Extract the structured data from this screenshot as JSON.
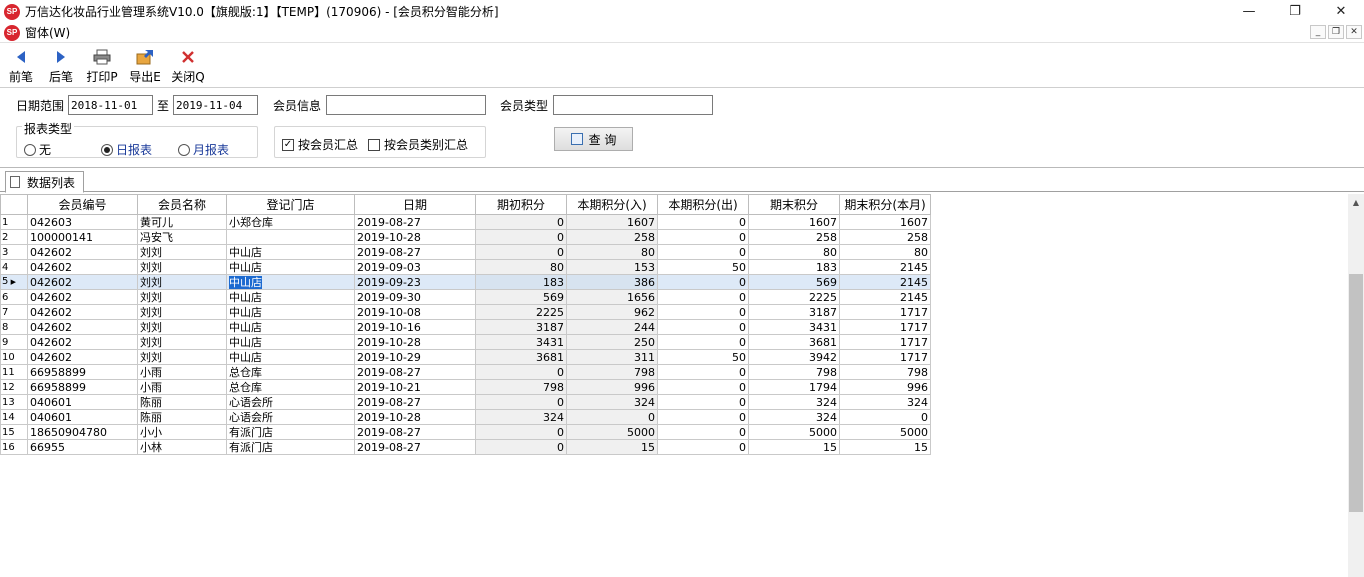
{
  "window": {
    "title": "万信达化妆品行业管理系统V10.0【旗舰版:1】【TEMP】(170906) - [会员积分智能分析]",
    "logo_text": "SP"
  },
  "menu": {
    "window_menu": "窗体(W)"
  },
  "toolbar": {
    "prev": "前笔",
    "next": "后笔",
    "print": "打印P",
    "export": "导出E",
    "close": "关闭Q"
  },
  "filter": {
    "date_range_label": "日期范围",
    "date_from": "2018-11-01",
    "to_label": "至",
    "date_to": "2019-11-04",
    "member_info_label": "会员信息",
    "member_info_value": "",
    "member_type_label": "会员类型",
    "member_type_value": "",
    "report_type_label": "报表类型",
    "report_options": [
      "无",
      "日报表",
      "月报表"
    ],
    "report_selected": "日报表",
    "by_member_label": "按会员汇总",
    "by_member_checked": true,
    "by_member_type_label": "按会员类别汇总",
    "by_member_type_checked": false,
    "query_label": "查 询"
  },
  "tab": {
    "label": "数据列表"
  },
  "table": {
    "headers": [
      "会员编号",
      "会员名称",
      "登记门店",
      "日期",
      "期初积分",
      "本期积分(入)",
      "本期积分(出)",
      "期末积分",
      "期末积分(本月)"
    ],
    "selected_row": 5,
    "rows": [
      {
        "no": "1",
        "id": "042603",
        "name": "黄可儿",
        "store": "小郑仓库",
        "date": "2019-08-27",
        "open": "0",
        "in": "1607",
        "out": "0",
        "close": "1607",
        "close_month": "1607"
      },
      {
        "no": "2",
        "id": "100000141",
        "name": "冯安飞",
        "store": "",
        "date": "2019-10-28",
        "open": "0",
        "in": "258",
        "out": "0",
        "close": "258",
        "close_month": "258"
      },
      {
        "no": "3",
        "id": "042602",
        "name": "刘刘",
        "store": "中山店",
        "date": "2019-08-27",
        "open": "0",
        "in": "80",
        "out": "0",
        "close": "80",
        "close_month": "80"
      },
      {
        "no": "4",
        "id": "042602",
        "name": "刘刘",
        "store": "中山店",
        "date": "2019-09-03",
        "open": "80",
        "in": "153",
        "out": "50",
        "close": "183",
        "close_month": "2145"
      },
      {
        "no": "5",
        "id": "042602",
        "name": "刘刘",
        "store": "中山店",
        "date": "2019-09-23",
        "open": "183",
        "in": "386",
        "out": "0",
        "close": "569",
        "close_month": "2145"
      },
      {
        "no": "6",
        "id": "042602",
        "name": "刘刘",
        "store": "中山店",
        "date": "2019-09-30",
        "open": "569",
        "in": "1656",
        "out": "0",
        "close": "2225",
        "close_month": "2145"
      },
      {
        "no": "7",
        "id": "042602",
        "name": "刘刘",
        "store": "中山店",
        "date": "2019-10-08",
        "open": "2225",
        "in": "962",
        "out": "0",
        "close": "3187",
        "close_month": "1717"
      },
      {
        "no": "8",
        "id": "042602",
        "name": "刘刘",
        "store": "中山店",
        "date": "2019-10-16",
        "open": "3187",
        "in": "244",
        "out": "0",
        "close": "3431",
        "close_month": "1717"
      },
      {
        "no": "9",
        "id": "042602",
        "name": "刘刘",
        "store": "中山店",
        "date": "2019-10-28",
        "open": "3431",
        "in": "250",
        "out": "0",
        "close": "3681",
        "close_month": "1717"
      },
      {
        "no": "10",
        "id": "042602",
        "name": "刘刘",
        "store": "中山店",
        "date": "2019-10-29",
        "open": "3681",
        "in": "311",
        "out": "50",
        "close": "3942",
        "close_month": "1717"
      },
      {
        "no": "11",
        "id": "66958899",
        "name": "小雨",
        "store": "总仓库",
        "date": "2019-08-27",
        "open": "0",
        "in": "798",
        "out": "0",
        "close": "798",
        "close_month": "798"
      },
      {
        "no": "12",
        "id": "66958899",
        "name": "小雨",
        "store": "总仓库",
        "date": "2019-10-21",
        "open": "798",
        "in": "996",
        "out": "0",
        "close": "1794",
        "close_month": "996"
      },
      {
        "no": "13",
        "id": "040601",
        "name": "陈丽",
        "store": "心语会所",
        "date": "2019-08-27",
        "open": "0",
        "in": "324",
        "out": "0",
        "close": "324",
        "close_month": "324"
      },
      {
        "no": "14",
        "id": "040601",
        "name": "陈丽",
        "store": "心语会所",
        "date": "2019-10-28",
        "open": "324",
        "in": "0",
        "out": "0",
        "close": "324",
        "close_month": "0"
      },
      {
        "no": "15",
        "id": "18650904780",
        "name": "小小",
        "store": "有派门店",
        "date": "2019-08-27",
        "open": "0",
        "in": "5000",
        "out": "0",
        "close": "5000",
        "close_month": "5000"
      },
      {
        "no": "16",
        "id": "66955",
        "name": "小林",
        "store": "有派门店",
        "date": "2019-08-27",
        "open": "0",
        "in": "15",
        "out": "0",
        "close": "15",
        "close_month": "15"
      }
    ]
  },
  "colors": {
    "accent": "#1c6ad0",
    "logo": "#d8262f",
    "selected_row": "#dde9f7"
  }
}
